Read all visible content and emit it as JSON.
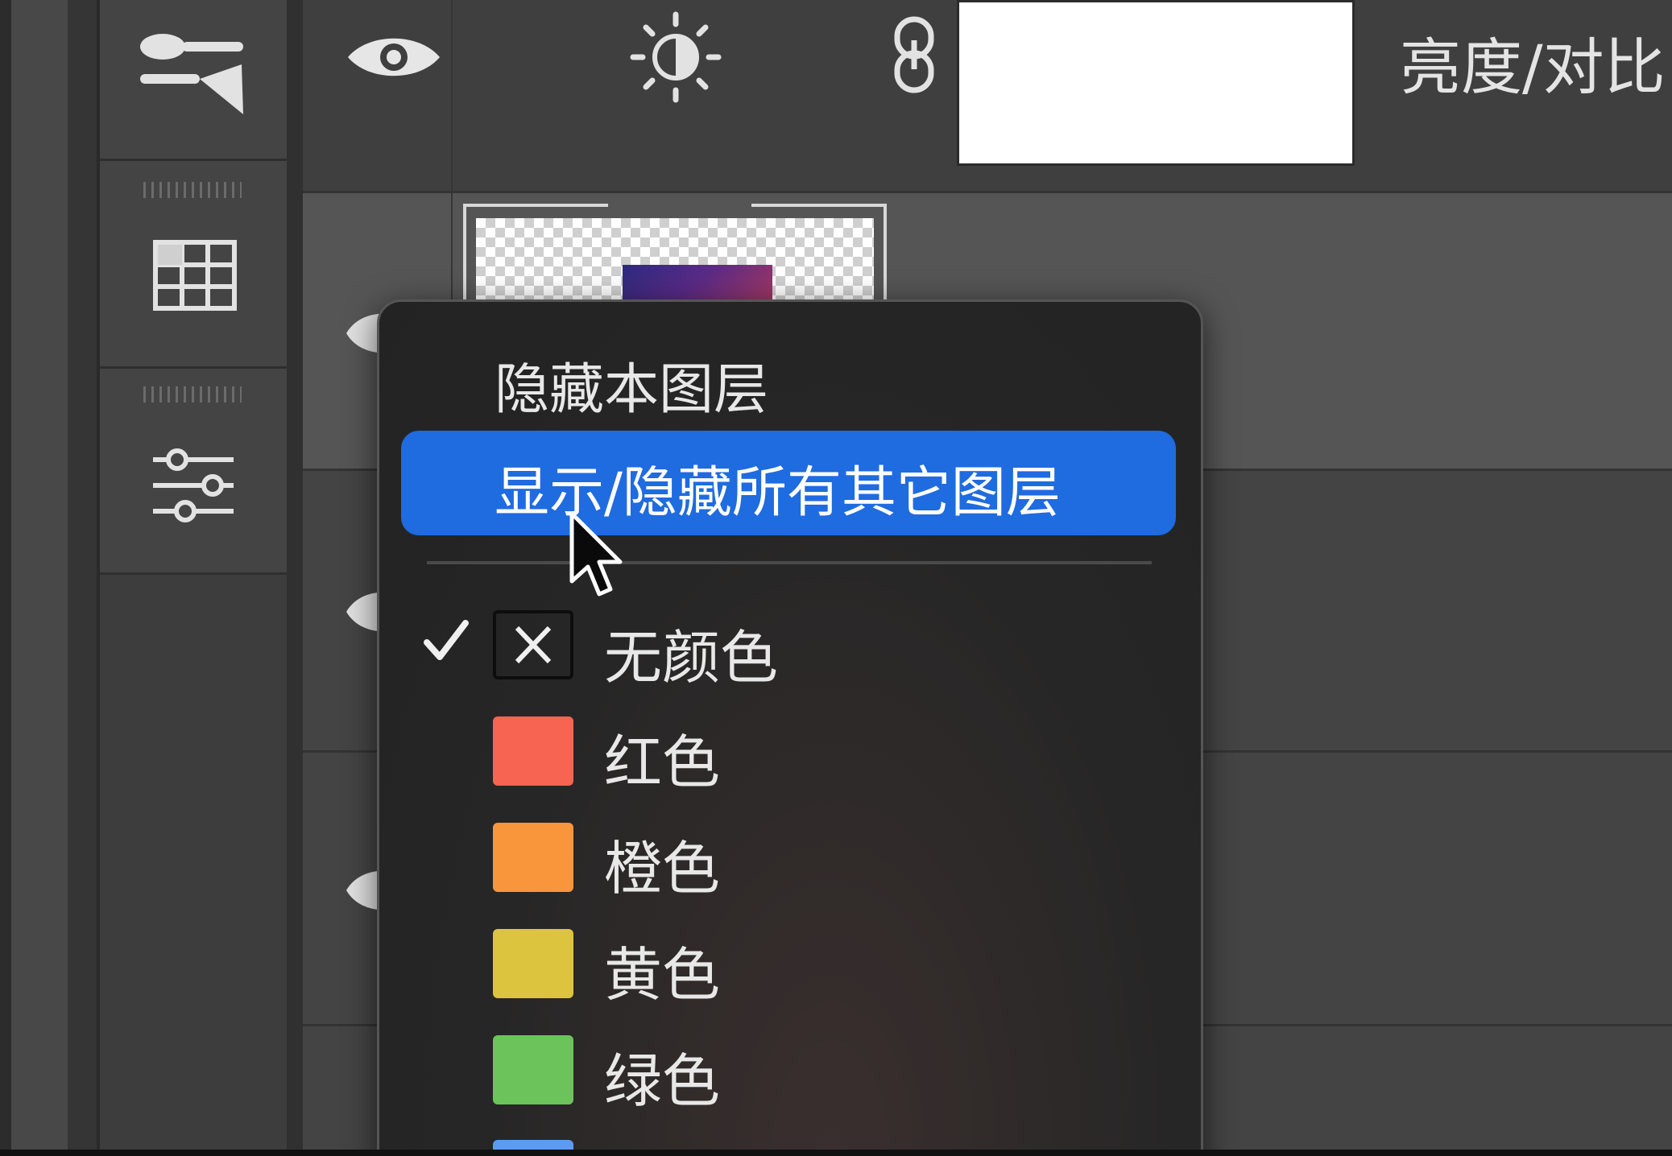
{
  "layers_panel": {
    "top_layer": {
      "name": "亮度/对比",
      "icons": [
        "eye-icon",
        "brightness-contrast-icon",
        "chain-link-icon"
      ]
    }
  },
  "context_menu": {
    "hide_this_layer": "隐藏本图层",
    "show_hide_all_other_layers": "显示/隐藏所有其它图层",
    "color_labels": [
      {
        "label": "无颜色",
        "color": "#1e1e1e",
        "checked": true,
        "icon": "x-icon"
      },
      {
        "label": "红色",
        "color": "#f86452"
      },
      {
        "label": "橙色",
        "color": "#f9953b"
      },
      {
        "label": "黄色",
        "color": "#dcc43e"
      },
      {
        "label": "绿色",
        "color": "#6cc35c"
      },
      {
        "label": "",
        "color": "#5b9cf2"
      }
    ]
  },
  "colors": {
    "highlight": "#1f6be0",
    "menu_background": "#262626",
    "panel_background": "#424242"
  }
}
